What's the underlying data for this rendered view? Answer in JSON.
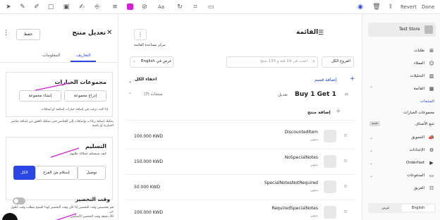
{
  "toolbar": {
    "font_label": "Aa",
    "revert": "Revert",
    "done": "Done",
    "colors": {
      "magenta": "#d41fd6",
      "accent": "#2a47e6"
    }
  },
  "edit_panel": {
    "title": "تعديل منتج",
    "save": "حفظ",
    "tabs": [
      "التعاريف",
      "المعلومات"
    ],
    "option_groups": {
      "heading": "مجموعات الخيارات",
      "import": "إدراج مجموعة",
      "create": "إنشاء مجموعة",
      "help1": "إذا كنت ترغب في إضافة خيارات إضافية أو إضافات",
      "help2": "يمكنك إضافة زيادات وإضافات إلى العناصر حتى يمكنك العثور من إضافة عناصر اختيارية أو بكمية"
    },
    "delivery": {
      "heading": "التسليم",
      "sub": "كيف سيستلم عملائك طلبهم",
      "options": [
        "توصيل",
        "إستلام من الفرع",
        "الكل"
      ]
    },
    "prep": {
      "heading": "وقت التحضير",
      "desc1": "قم بتخصيص وقت التحضير إذا كان وقت التحضير لهذا المنتج يتطلب وقت أطول من",
      "desc2": "30 دقيقة وقت التحضير الأساسي"
    }
  },
  "center": {
    "title": "القائمة",
    "help_center": "مركز مساعدة القائمة",
    "branch_select": "الفروع الكل",
    "search_placeholder": "ابحث في 19 فئة و 135 منتج",
    "view_lang": "عرض في English",
    "add_section": "إضافة قسم",
    "hide_all": "اخفاء الكل",
    "section": {
      "name": "Buy 1 Get 1",
      "edit": "تعديل",
      "products_count": "منتجات (7)"
    },
    "add_product": "إضافة منتج",
    "products": [
      {
        "name": "DiscountedItem",
        "sub": "منتهي",
        "price": "100.000 KWD"
      },
      {
        "name": "NoSpecialNotes",
        "sub": "منتهي",
        "price": "150.000 KWD"
      },
      {
        "name": "SpecialNotesNotRequired",
        "sub": "منتهي",
        "price": "50.000 KWD"
      },
      {
        "name": "RequiredSpecialNotes",
        "sub": "منتهي",
        "price": "100.000 KWD"
      }
    ]
  },
  "sidebar": {
    "store": "Test Store",
    "items": {
      "orders": "طلبات",
      "customers": "العملاء",
      "analytics": "التحليلات",
      "menu": "القائمة",
      "products": "المنتجات",
      "option_groups": "مجموعات الخيارات",
      "categories": "تتبع الأصناف",
      "categories_badge": "جديد",
      "marketing": "التسويق",
      "settings": "الإعدادات",
      "orderfast": "Orderfast",
      "payments": "المدفوعات",
      "team": "الفريق"
    },
    "lang": {
      "arabic": "عربي",
      "english": "English"
    }
  }
}
